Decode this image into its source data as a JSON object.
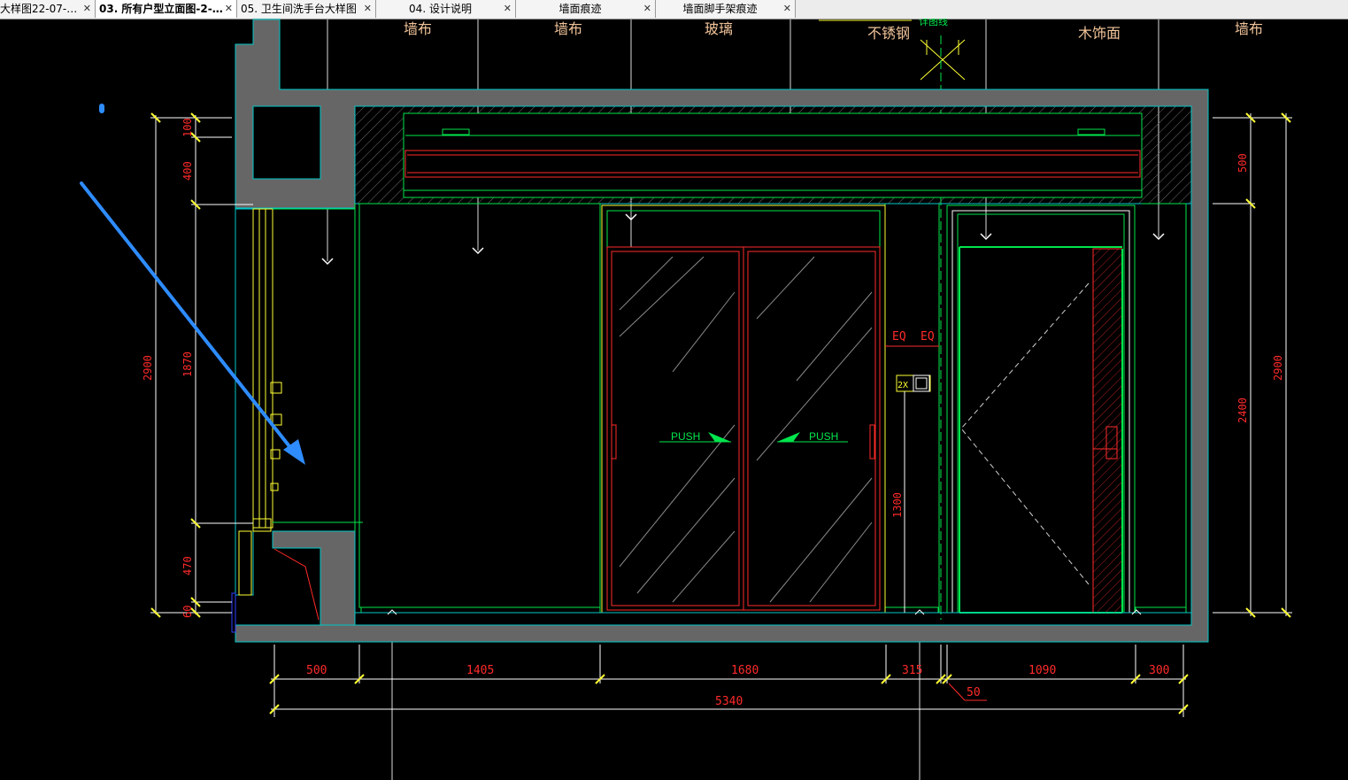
{
  "tabs": [
    {
      "label": "大样图22-07-…",
      "active": false
    },
    {
      "label": "03. 所有户型立面图-2-…",
      "active": true
    },
    {
      "label": "05. 卫生间洗手台大样图",
      "active": false
    },
    {
      "label": "04. 设计说明",
      "active": false
    },
    {
      "label": "墙面痕迹",
      "active": false
    },
    {
      "label": "墙面脚手架痕迹",
      "active": false
    }
  ],
  "close_glyph": "✕",
  "drawing": {
    "material_labels": [
      "墙布",
      "墙布",
      "玻璃",
      "不锈钢",
      "木饰面",
      "墙布"
    ],
    "door_labels": {
      "left_push": "PUSH",
      "right_push": "PUSH"
    },
    "eq_labels": [
      "EQ",
      "EQ"
    ],
    "switch_label": "2X",
    "bottom_dims": [
      "500",
      "1405",
      "1680",
      "315",
      "1090",
      "300"
    ],
    "total_dim": "5340",
    "small_dim": "50",
    "left_dims_inner": [
      "100",
      "400",
      "1870",
      "470",
      "60"
    ],
    "left_dim_total": "2900",
    "right_dims_inner": [
      "500",
      "2400"
    ],
    "right_dim_total": "2900",
    "mid_dim": "1300",
    "top_fragment": "详图线"
  },
  "colors": {
    "background": "#000000",
    "wall": "#666666",
    "outline_cyan": "#00c8c8",
    "line_green": "#00e64d",
    "line_red": "#ff2a2a",
    "line_yellow": "#ffff33",
    "line_white": "#e6e6e6",
    "arrow_blue": "#2e8cff",
    "label_orange": "#f2c49a"
  }
}
